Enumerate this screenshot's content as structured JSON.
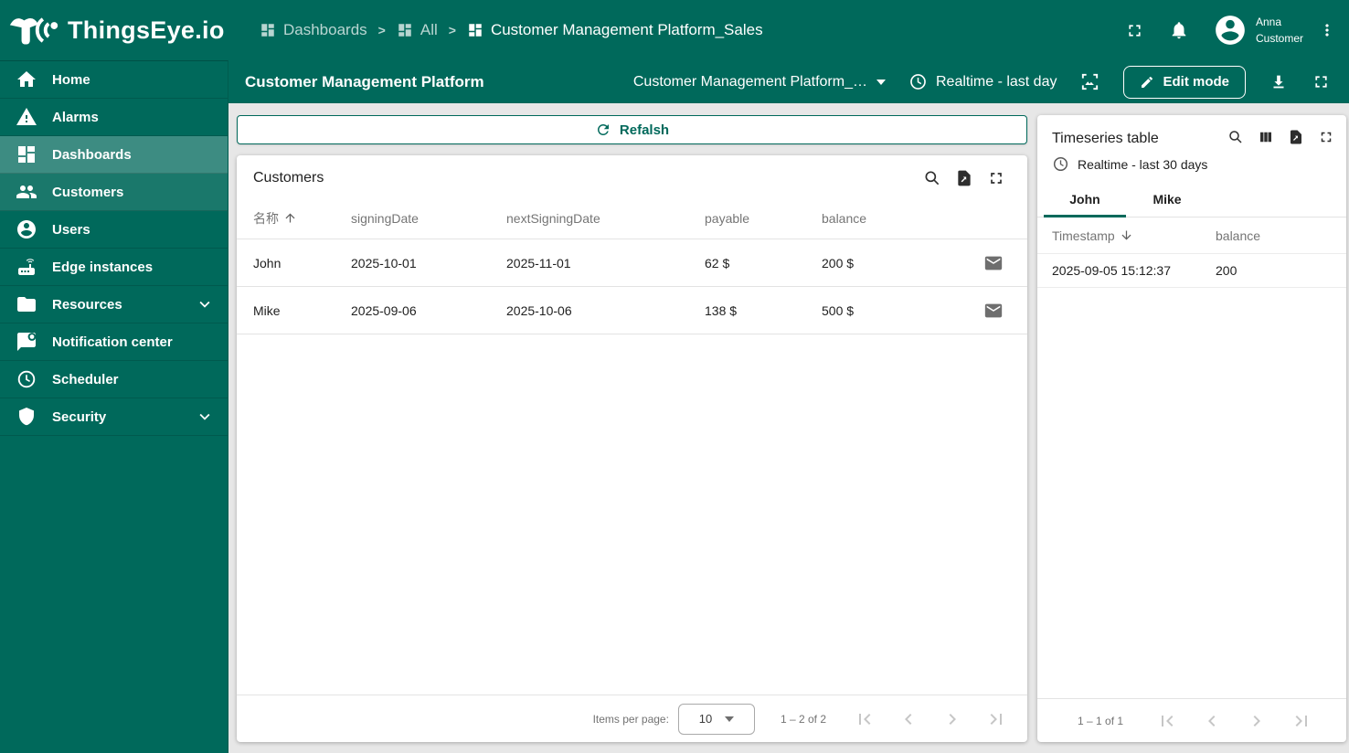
{
  "brand": {
    "name": "ThingsEye.io"
  },
  "colors": {
    "teal": "#00695B",
    "content_bg": "#e7e7e7"
  },
  "topbar": {
    "separator": ">",
    "breadcrumbs": [
      "Dashboards",
      "All",
      "Customer Management Platform_Sales"
    ],
    "user": {
      "name": "Anna",
      "role": "Customer"
    }
  },
  "subheader": {
    "title": "Customer Management Platform",
    "state_selector": "Customer Management Platform_…",
    "timewindow": "Realtime - last day",
    "edit_mode_label": "Edit mode"
  },
  "sidebar": {
    "items": [
      {
        "label": "Home"
      },
      {
        "label": "Alarms"
      },
      {
        "label": "Dashboards"
      },
      {
        "label": "Customers"
      },
      {
        "label": "Users"
      },
      {
        "label": "Edge instances"
      },
      {
        "label": "Resources"
      },
      {
        "label": "Notification center"
      },
      {
        "label": "Scheduler"
      },
      {
        "label": "Security"
      }
    ]
  },
  "main": {
    "refresh_label": "Refalsh",
    "customers": {
      "title": "Customers",
      "columns": [
        "名称",
        "signingDate",
        "nextSigningDate",
        "payable",
        "balance"
      ],
      "rows": [
        {
          "name": "John",
          "signingDate": "2025-10-01",
          "nextSigningDate": "2025-11-01",
          "payable": "62 $",
          "balance": "200 $"
        },
        {
          "name": "Mike",
          "signingDate": "2025-09-06",
          "nextSigningDate": "2025-10-06",
          "payable": "138 $",
          "balance": "500 $"
        }
      ],
      "paginator": {
        "label": "Items per page:",
        "page_size": "10",
        "range": "1 – 2 of 2"
      }
    },
    "timeseries": {
      "title": "Timeseries table",
      "timewindow": "Realtime - last 30 days",
      "tabs": [
        "John",
        "Mike"
      ],
      "columns": [
        "Timestamp",
        "balance"
      ],
      "rows": [
        {
          "timestamp": "2025-09-05 15:12:37",
          "balance": "200"
        }
      ],
      "paginator": {
        "range": "1 – 1 of 1"
      }
    }
  }
}
